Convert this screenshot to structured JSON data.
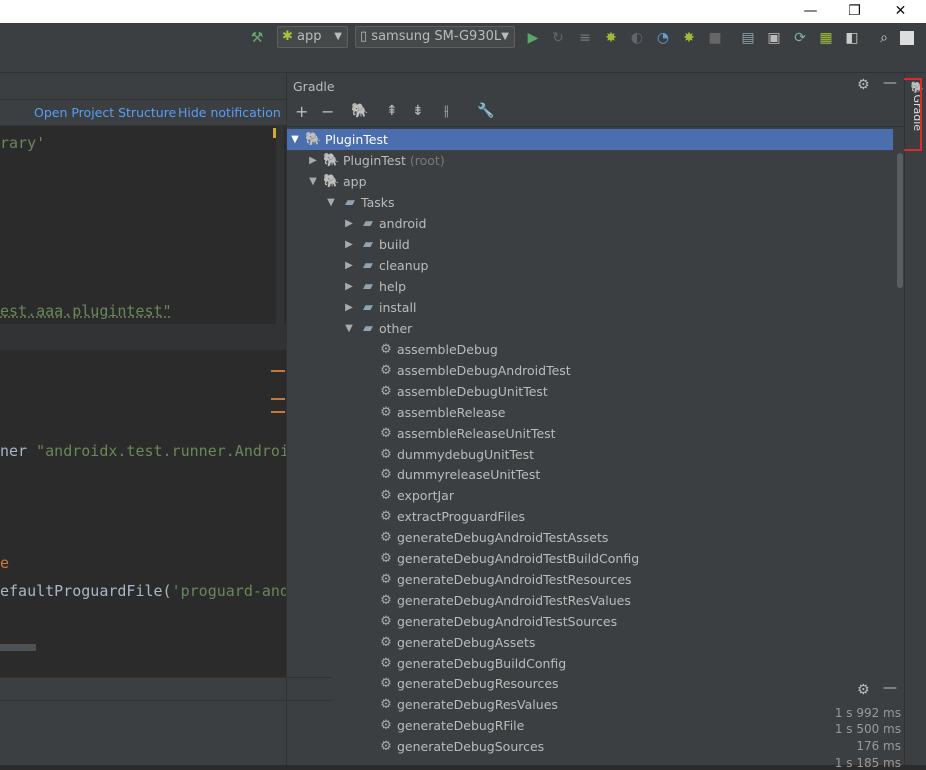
{
  "window": {
    "min_glyph": "—",
    "max_glyph": "❐",
    "close_glyph": "✕"
  },
  "toolbar": {
    "run_config": "app",
    "device": "samsung SM-G930L"
  },
  "notification": {
    "open_label": "Open Project Structure",
    "hide_label": "Hide notification"
  },
  "editor_top": {
    "line1": "rary'",
    "line2": "est.aaa.plugintest\""
  },
  "editor_bottom": {
    "line1_plain": "ner ",
    "line1_str": "\"androidx.test.runner.Androi",
    "line2": "e",
    "line3_plain": "efaultProguardFile(",
    "line3_str": "'proguard-and"
  },
  "gradle": {
    "title": "Gradle",
    "strip_label": "Gradle",
    "tree": {
      "root": "PluginTest",
      "root_child": "PluginTest",
      "root_child_suffix": "(root)",
      "app": "app",
      "tasks": "Tasks",
      "groups": [
        "android",
        "build",
        "cleanup",
        "help",
        "install",
        "other"
      ],
      "other_tasks": [
        "assembleDebug",
        "assembleDebugAndroidTest",
        "assembleDebugUnitTest",
        "assembleRelease",
        "assembleReleaseUnitTest",
        "dummydebugUnitTest",
        "dummyreleaseUnitTest",
        "exportJar",
        "extractProguardFiles",
        "generateDebugAndroidTestAssets",
        "generateDebugAndroidTestBuildConfig",
        "generateDebugAndroidTestResources",
        "generateDebugAndroidTestResValues",
        "generateDebugAndroidTestSources",
        "generateDebugAssets",
        "generateDebugBuildConfig",
        "generateDebugResources",
        "generateDebugResValues",
        "generateDebugRFile",
        "generateDebugSources"
      ]
    }
  },
  "build_times": [
    "1 s 992 ms",
    "1 s 500 ms",
    "176 ms",
    "1 s 185 ms"
  ],
  "colors": {
    "selection": "#4b6eaf",
    "highlight": "#e0282e",
    "link": "#589df6"
  }
}
